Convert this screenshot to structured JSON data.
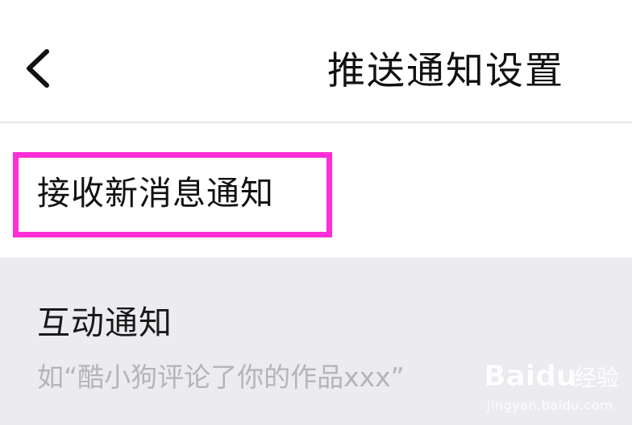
{
  "navbar": {
    "title": "推送通知设置",
    "back_icon": "chevron-left-icon"
  },
  "section": {
    "title": "接收新消息通知",
    "highlight_color": "#ff2ed6"
  },
  "list": {
    "items": [
      {
        "title": "互动通知",
        "description": "如“酷小狗评论了你的作品xxx”"
      }
    ]
  },
  "watermark": {
    "logo": "Baidu",
    "brand": "经验",
    "url": "jingyan.baidu.com"
  },
  "colors": {
    "background": "#ffffff",
    "list_background": "#ececf0",
    "title_text": "#111111",
    "secondary_text": "#b5b5b9",
    "divider": "#e4e4e6"
  }
}
